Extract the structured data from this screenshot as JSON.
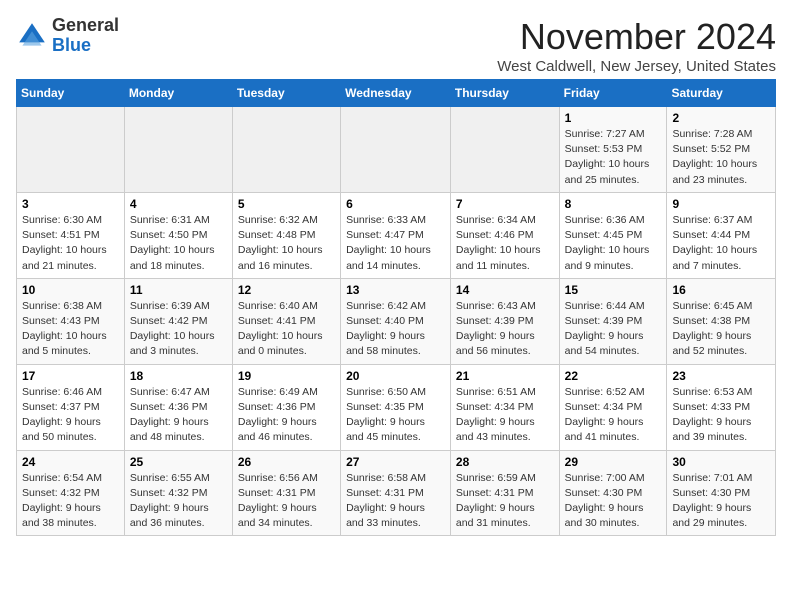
{
  "logo": {
    "general": "General",
    "blue": "Blue"
  },
  "header": {
    "month": "November 2024",
    "location": "West Caldwell, New Jersey, United States"
  },
  "days_of_week": [
    "Sunday",
    "Monday",
    "Tuesday",
    "Wednesday",
    "Thursday",
    "Friday",
    "Saturday"
  ],
  "weeks": [
    [
      {
        "day": "",
        "detail": ""
      },
      {
        "day": "",
        "detail": ""
      },
      {
        "day": "",
        "detail": ""
      },
      {
        "day": "",
        "detail": ""
      },
      {
        "day": "",
        "detail": ""
      },
      {
        "day": "1",
        "detail": "Sunrise: 7:27 AM\nSunset: 5:53 PM\nDaylight: 10 hours and 25 minutes."
      },
      {
        "day": "2",
        "detail": "Sunrise: 7:28 AM\nSunset: 5:52 PM\nDaylight: 10 hours and 23 minutes."
      }
    ],
    [
      {
        "day": "3",
        "detail": "Sunrise: 6:30 AM\nSunset: 4:51 PM\nDaylight: 10 hours and 21 minutes."
      },
      {
        "day": "4",
        "detail": "Sunrise: 6:31 AM\nSunset: 4:50 PM\nDaylight: 10 hours and 18 minutes."
      },
      {
        "day": "5",
        "detail": "Sunrise: 6:32 AM\nSunset: 4:48 PM\nDaylight: 10 hours and 16 minutes."
      },
      {
        "day": "6",
        "detail": "Sunrise: 6:33 AM\nSunset: 4:47 PM\nDaylight: 10 hours and 14 minutes."
      },
      {
        "day": "7",
        "detail": "Sunrise: 6:34 AM\nSunset: 4:46 PM\nDaylight: 10 hours and 11 minutes."
      },
      {
        "day": "8",
        "detail": "Sunrise: 6:36 AM\nSunset: 4:45 PM\nDaylight: 10 hours and 9 minutes."
      },
      {
        "day": "9",
        "detail": "Sunrise: 6:37 AM\nSunset: 4:44 PM\nDaylight: 10 hours and 7 minutes."
      }
    ],
    [
      {
        "day": "10",
        "detail": "Sunrise: 6:38 AM\nSunset: 4:43 PM\nDaylight: 10 hours and 5 minutes."
      },
      {
        "day": "11",
        "detail": "Sunrise: 6:39 AM\nSunset: 4:42 PM\nDaylight: 10 hours and 3 minutes."
      },
      {
        "day": "12",
        "detail": "Sunrise: 6:40 AM\nSunset: 4:41 PM\nDaylight: 10 hours and 0 minutes."
      },
      {
        "day": "13",
        "detail": "Sunrise: 6:42 AM\nSunset: 4:40 PM\nDaylight: 9 hours and 58 minutes."
      },
      {
        "day": "14",
        "detail": "Sunrise: 6:43 AM\nSunset: 4:39 PM\nDaylight: 9 hours and 56 minutes."
      },
      {
        "day": "15",
        "detail": "Sunrise: 6:44 AM\nSunset: 4:39 PM\nDaylight: 9 hours and 54 minutes."
      },
      {
        "day": "16",
        "detail": "Sunrise: 6:45 AM\nSunset: 4:38 PM\nDaylight: 9 hours and 52 minutes."
      }
    ],
    [
      {
        "day": "17",
        "detail": "Sunrise: 6:46 AM\nSunset: 4:37 PM\nDaylight: 9 hours and 50 minutes."
      },
      {
        "day": "18",
        "detail": "Sunrise: 6:47 AM\nSunset: 4:36 PM\nDaylight: 9 hours and 48 minutes."
      },
      {
        "day": "19",
        "detail": "Sunrise: 6:49 AM\nSunset: 4:36 PM\nDaylight: 9 hours and 46 minutes."
      },
      {
        "day": "20",
        "detail": "Sunrise: 6:50 AM\nSunset: 4:35 PM\nDaylight: 9 hours and 45 minutes."
      },
      {
        "day": "21",
        "detail": "Sunrise: 6:51 AM\nSunset: 4:34 PM\nDaylight: 9 hours and 43 minutes."
      },
      {
        "day": "22",
        "detail": "Sunrise: 6:52 AM\nSunset: 4:34 PM\nDaylight: 9 hours and 41 minutes."
      },
      {
        "day": "23",
        "detail": "Sunrise: 6:53 AM\nSunset: 4:33 PM\nDaylight: 9 hours and 39 minutes."
      }
    ],
    [
      {
        "day": "24",
        "detail": "Sunrise: 6:54 AM\nSunset: 4:32 PM\nDaylight: 9 hours and 38 minutes."
      },
      {
        "day": "25",
        "detail": "Sunrise: 6:55 AM\nSunset: 4:32 PM\nDaylight: 9 hours and 36 minutes."
      },
      {
        "day": "26",
        "detail": "Sunrise: 6:56 AM\nSunset: 4:31 PM\nDaylight: 9 hours and 34 minutes."
      },
      {
        "day": "27",
        "detail": "Sunrise: 6:58 AM\nSunset: 4:31 PM\nDaylight: 9 hours and 33 minutes."
      },
      {
        "day": "28",
        "detail": "Sunrise: 6:59 AM\nSunset: 4:31 PM\nDaylight: 9 hours and 31 minutes."
      },
      {
        "day": "29",
        "detail": "Sunrise: 7:00 AM\nSunset: 4:30 PM\nDaylight: 9 hours and 30 minutes."
      },
      {
        "day": "30",
        "detail": "Sunrise: 7:01 AM\nSunset: 4:30 PM\nDaylight: 9 hours and 29 minutes."
      }
    ]
  ]
}
